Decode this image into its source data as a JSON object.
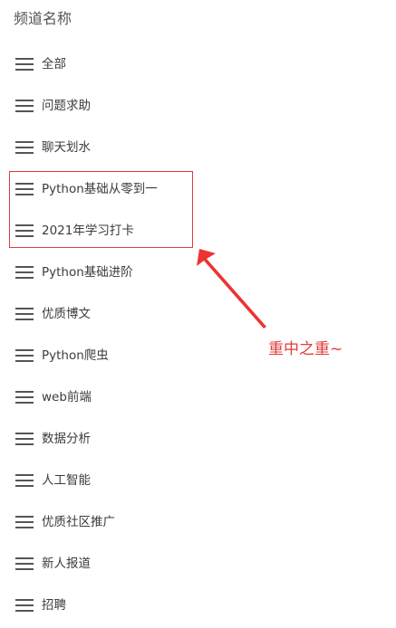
{
  "panel": {
    "title": "频道名称"
  },
  "channels": [
    {
      "label": "全部",
      "icon": "menu-icon"
    },
    {
      "label": "问题求助",
      "icon": "menu-icon"
    },
    {
      "label": "聊天划水",
      "icon": "menu-icon"
    },
    {
      "label": "Python基础从零到一",
      "icon": "menu-icon"
    },
    {
      "label": "2021年学习打卡",
      "icon": "menu-icon"
    },
    {
      "label": "Python基础进阶",
      "icon": "menu-icon"
    },
    {
      "label": "优质博文",
      "icon": "menu-icon"
    },
    {
      "label": "Python爬虫",
      "icon": "menu-icon"
    },
    {
      "label": "web前端",
      "icon": "menu-icon"
    },
    {
      "label": "数据分析",
      "icon": "menu-icon"
    },
    {
      "label": "人工智能",
      "icon": "menu-icon"
    },
    {
      "label": "优质社区推广",
      "icon": "menu-icon"
    },
    {
      "label": "新人报道",
      "icon": "menu-icon"
    },
    {
      "label": "招聘",
      "icon": "menu-icon"
    }
  ],
  "annotation": {
    "text": "重中之重~",
    "color": "#e23b3b"
  }
}
